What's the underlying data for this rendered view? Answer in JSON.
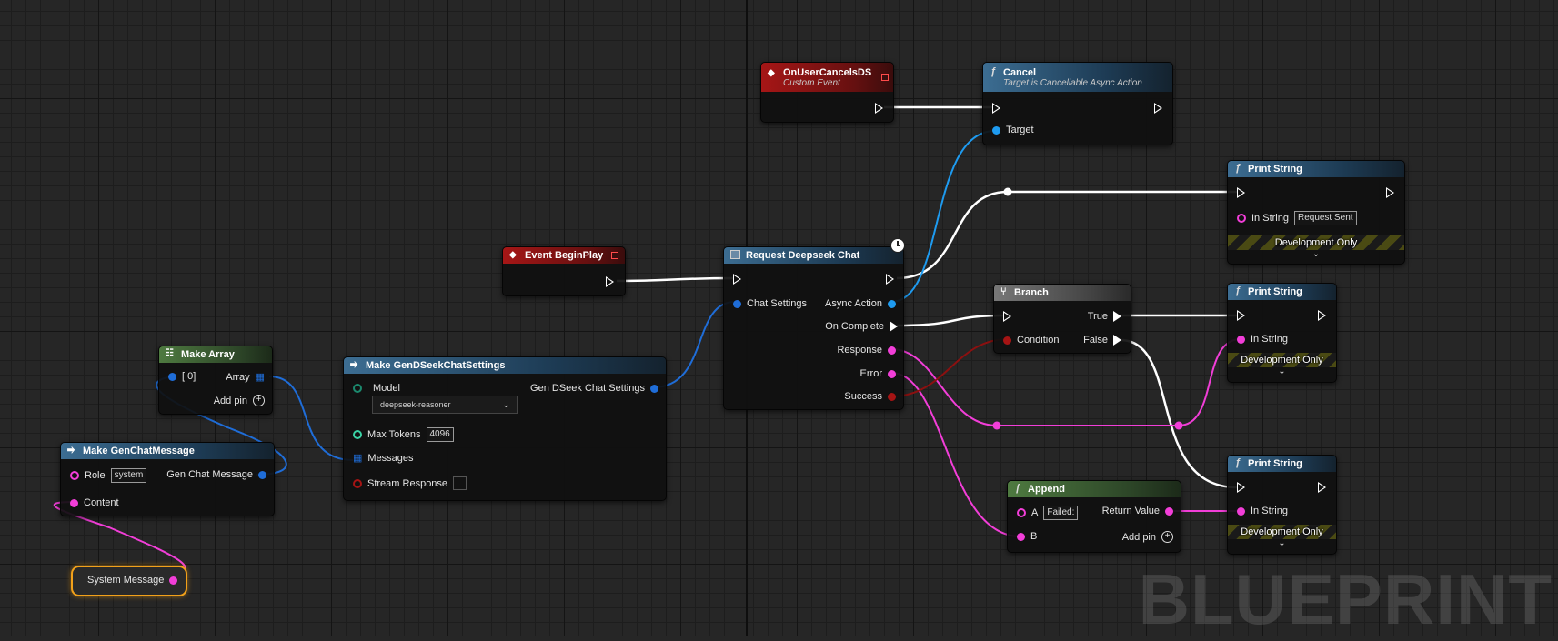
{
  "graph": {
    "watermark": "BLUEPRINT",
    "colors": {
      "exec": "#ffffff",
      "object": "#1e9bf0",
      "string": "#f23ed8",
      "boolean": "#a61414",
      "struct": "#1f6dd8",
      "integer": "#3ad2a5"
    }
  },
  "nodes": {
    "on_user_cancels": {
      "title": "OnUserCancelsDS",
      "subtitle": "Custom Event"
    },
    "cancel": {
      "title": "Cancel",
      "subtitle": "Target is Cancellable Async Action",
      "target_label": "Target"
    },
    "event_begin_play": {
      "title": "Event BeginPlay"
    },
    "request_deepseek_chat": {
      "title": "Request Deepseek Chat",
      "chat_settings": "Chat Settings",
      "async_action": "Async Action",
      "on_complete": "On Complete",
      "response": "Response",
      "error": "Error",
      "success": "Success"
    },
    "branch": {
      "title": "Branch",
      "condition": "Condition",
      "true_label": "True",
      "false_label": "False"
    },
    "print_string_1": {
      "title": "Print String",
      "in_string_label": "In String",
      "in_string_value": "Request Sent",
      "dev_only": "Development Only"
    },
    "print_string_2": {
      "title": "Print String",
      "in_string_label": "In String",
      "dev_only": "Development Only"
    },
    "print_string_3": {
      "title": "Print String",
      "in_string_label": "In String",
      "dev_only": "Development Only"
    },
    "append": {
      "title": "Append",
      "a_label": "A",
      "a_value": "Failed:",
      "b_label": "B",
      "return_value": "Return Value",
      "add_pin": "Add pin"
    },
    "make_array": {
      "title": "Make Array",
      "index_label": "[ 0]",
      "array_label": "Array",
      "add_pin": "Add pin"
    },
    "make_settings": {
      "title": "Make GenDSeekChatSettings",
      "model_label": "Model",
      "model_value": "deepseek-reasoner",
      "output_label": "Gen DSeek Chat Settings",
      "max_tokens_label": "Max Tokens",
      "max_tokens_value": "4096",
      "messages_label": "Messages",
      "stream_label": "Stream Response",
      "stream_checked": false
    },
    "make_chat_message": {
      "title": "Make GenChatMessage",
      "role_label": "Role",
      "role_value": "system",
      "output_label": "Gen Chat Message",
      "content_label": "Content"
    },
    "system_message": {
      "label": "System Message"
    }
  }
}
